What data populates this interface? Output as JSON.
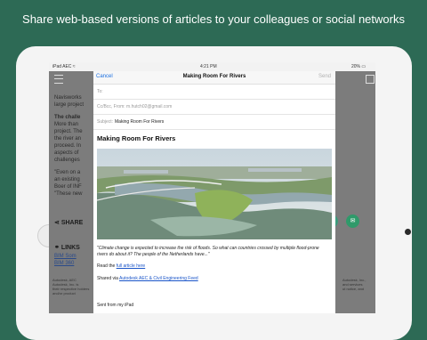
{
  "banner": {
    "text": "Share web-based versions of articles to your colleagues or social networks"
  },
  "status_bar": {
    "carrier": "iPad  AEC  ≈",
    "time": "4:21 PM",
    "battery": "20% ▭"
  },
  "background": {
    "lines": [
      "Navisworks",
      "large project",
      "",
      "The challe",
      "More than",
      "project. The",
      "the river an",
      "proceed. In",
      "aspects of",
      "challenges",
      "",
      "\"Even on a",
      "an existing",
      "Boer of INF",
      "\"These new"
    ],
    "share_label": "SHARE",
    "links_label": "LINKS",
    "link1": "BIM Som",
    "link2": "BIM 360",
    "footer_left": "Autodesk, AEC",
    "footer_left2": "Autodesk, Inc. is",
    "footer_left3": "their respective holders",
    "footer_left4": "and/or product",
    "footer_right": "Autodesk, Inc.,",
    "footer_right2": "and services",
    "footer_right3": "ut notice, and"
  },
  "modal": {
    "cancel_label": "Cancel",
    "title": "Making Room For Rivers",
    "send_label": "Send",
    "to_label": "To:",
    "from_label": "Cc/Bcc, From: m.hutch02@gmail.com",
    "subject_label": "Subject:",
    "subject_value": "Making Room For Rivers",
    "article_title": "Making Room For Rivers",
    "quote": "\"Climate change is expected to increase the risk of floods. So what can countries crossed by multiple flood-prone rivers do about it? The people of the Netherlands have...\"",
    "read_prefix": "Read the",
    "read_link": "full article here",
    "shared_prefix": "Shared via",
    "shared_link": "Autodesk AEC & Civil Engineering Feed",
    "signature": "Sent from my iPad"
  },
  "colors": {
    "background": "#2d6a55",
    "accent_link": "#1b6fe0"
  }
}
